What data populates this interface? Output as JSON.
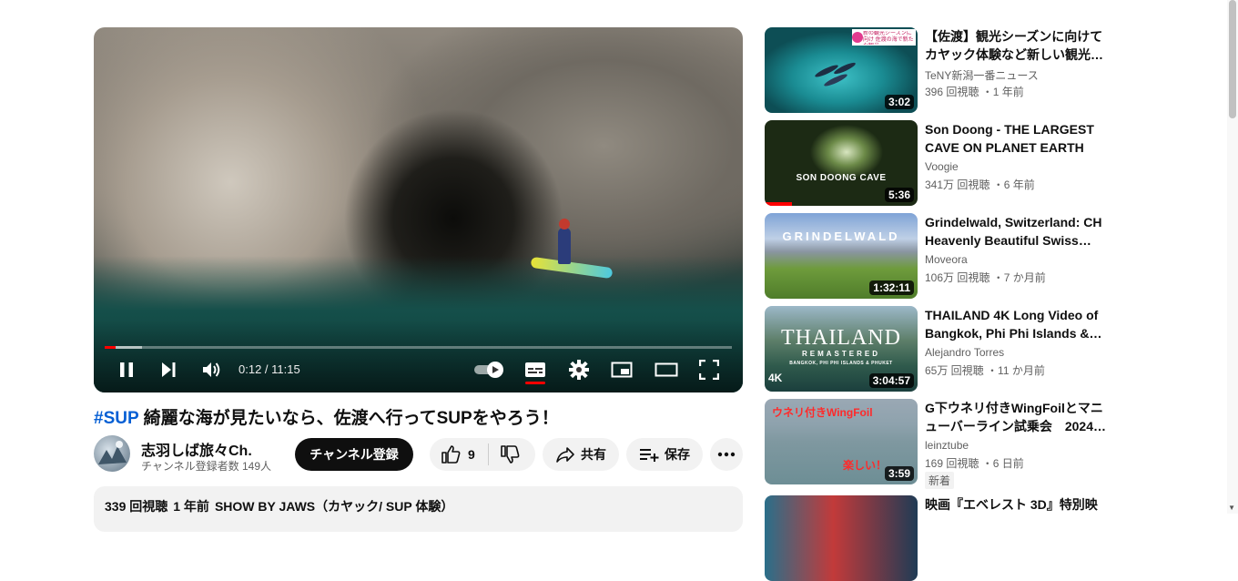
{
  "player": {
    "time": "0:12 / 11:15",
    "progress_fraction": 0.018,
    "buffered_fraction": 0.06
  },
  "video": {
    "title_hashtag": "#SUP",
    "title_rest": " 綺麗な海が見たいなら、佐渡へ行ってSUPをやろう！",
    "channel_name": "志羽しば旅々Ch.",
    "channel_subs": "チャンネル登録者数 149人",
    "subscribe_label": "チャンネル登録",
    "like_count": "9",
    "share_label": "共有",
    "save_label": "保存",
    "desc_views": "339 回視聴",
    "desc_age": "1 年前",
    "desc_tags": "SHOW BY JAWS（カヤック/ SUP 体験）"
  },
  "recommendations": [
    {
      "title": "【佐渡】観光シーズンに向けてカヤック体験など新しい観光…",
      "channel": "TeNY新潟一番ニュース",
      "views": "396 回視聴",
      "age": "1 年前",
      "duration": "3:02",
      "thumb_caption": "新の観光シーズンに向け 佐渡の海で新たな観光",
      "thumb_badge": "ネクスト"
    },
    {
      "title": "Son Doong - THE LARGEST CAVE ON PLANET EARTH",
      "channel": "Voogie",
      "views": "341万 回視聴",
      "age": "6 年前",
      "duration": "5:36",
      "thumb_caption": "SON DOONG CAVE",
      "watched_fraction": 0.18
    },
    {
      "title": "Grindelwald, Switzerland: CH Heavenly Beautiful Swiss Tow…",
      "channel": "Moveora",
      "views": "106万 回視聴",
      "age": "7 か月前",
      "duration": "1:32:11",
      "thumb_caption": "GRINDELWALD"
    },
    {
      "title": "THAILAND 4K Long Video of Bangkok, Phi Phi Islands &…",
      "channel": "Alejandro Torres",
      "views": "65万 回視聴",
      "age": "11 か月前",
      "duration": "3:04:57",
      "thumb_caption": "THAILAND",
      "thumb_sub": "REMASTERED",
      "thumb_small": "BANGKOK, PHI PHI ISLANDS & PHUKET",
      "thumb_badge": "4K"
    },
    {
      "title": "G下ウネリ付きWingFoilとマニューバーライン試乗会　2024…",
      "channel": "leinztube",
      "views": "169 回視聴",
      "age": "6 日前",
      "duration": "3:59",
      "badge": "新着",
      "thumb_caption": "ウネリ付きWingFoil",
      "thumb_sub": "楽しい！"
    },
    {
      "title": "映画『エベレスト 3D』特別映",
      "channel": "",
      "views": "",
      "age": "",
      "duration": ""
    }
  ],
  "colors": {
    "accent_red": "#ff0000",
    "link_blue": "#065fd4",
    "subscribe_bg": "#0f0f0f",
    "pill_bg": "#f2f2f2"
  }
}
